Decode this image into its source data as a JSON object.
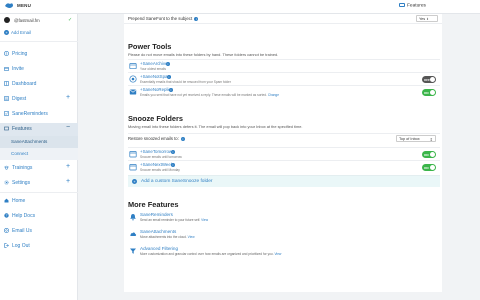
{
  "topbar": {
    "menu_label": "MENU",
    "features_tab": "Features"
  },
  "sidebar": {
    "account_email": "@fastmail.fm",
    "add_email": "Add Email",
    "items": [
      {
        "label": "Pricing",
        "icon": "pricing-icon"
      },
      {
        "label": "Invite",
        "icon": "invite-icon"
      },
      {
        "label": "Dashboard",
        "icon": "dashboard-icon"
      },
      {
        "label": "Digest",
        "icon": "digest-icon",
        "expand": "+"
      },
      {
        "label": "SaneReminders",
        "icon": "reminders-icon"
      },
      {
        "label": "Features",
        "icon": "features-icon",
        "expand": "−"
      },
      {
        "label": "Trainings",
        "icon": "trainings-icon",
        "expand": "+"
      },
      {
        "label": "Settings",
        "icon": "settings-icon",
        "expand": "+"
      },
      {
        "label": "Home",
        "icon": "home-icon"
      },
      {
        "label": "Help Docs",
        "icon": "help-icon"
      },
      {
        "label": "Email Us",
        "icon": "email-icon"
      },
      {
        "label": "Log Out",
        "icon": "logout-icon"
      }
    ],
    "subitems": [
      {
        "label": "SaneAttachments"
      },
      {
        "label": "Connect"
      }
    ]
  },
  "main": {
    "prepend": {
      "label": "Prepend SaneFont to the subject",
      "value": "Yes"
    },
    "power_tools": {
      "title": "Power Tools",
      "description": "Please do not move emails into these folders by hand. These folders cannot be trained.",
      "rows": [
        {
          "name": "+SaneArchive",
          "desc": "Your oldest emails",
          "link": ""
        },
        {
          "name": "+SaneNotSpam",
          "desc": "Essentially emails that should be rescued from your Spam folder",
          "link": "",
          "toggle": "OFF"
        },
        {
          "name": "+SaneNoReplies",
          "desc": "Emails you sent that have not yet received a reply. These emails will be marked as sorted.",
          "link": "Change",
          "toggle": "ON"
        }
      ]
    },
    "snooze": {
      "title": "Snooze Folders",
      "description": "Moving email into these folders defers it. The email will pop back into your Inbox at the specified time.",
      "restore_label": "Restore snoozed emails to:",
      "restore_value": "Top of Inbox",
      "rows": [
        {
          "name": "+SaneTomorrow",
          "desc": "Snooze emails until tomorrow",
          "toggle": "ON"
        },
        {
          "name": "+SaneNextWeek",
          "desc": "Snooze emails until Monday",
          "toggle": "ON"
        }
      ],
      "add_label": "Add a custom SaneSnooze folder"
    },
    "more_features": {
      "title": "More Features",
      "items": [
        {
          "name": "SaneReminders",
          "desc": "Send an email reminder to your future self.",
          "link": "View"
        },
        {
          "name": "SaneAttachments",
          "desc": "Move attachments into the cloud.",
          "link": "View"
        },
        {
          "name": "Advanced Filtering",
          "desc": "More customization and granular control over how emails are organized and prioritized for you.",
          "link": "View"
        }
      ]
    }
  },
  "colors": {
    "accent": "#2f7fc4",
    "toggle_on": "#3bb54a",
    "toggle_off": "#555555",
    "active_bg": "#dfe7ef"
  }
}
